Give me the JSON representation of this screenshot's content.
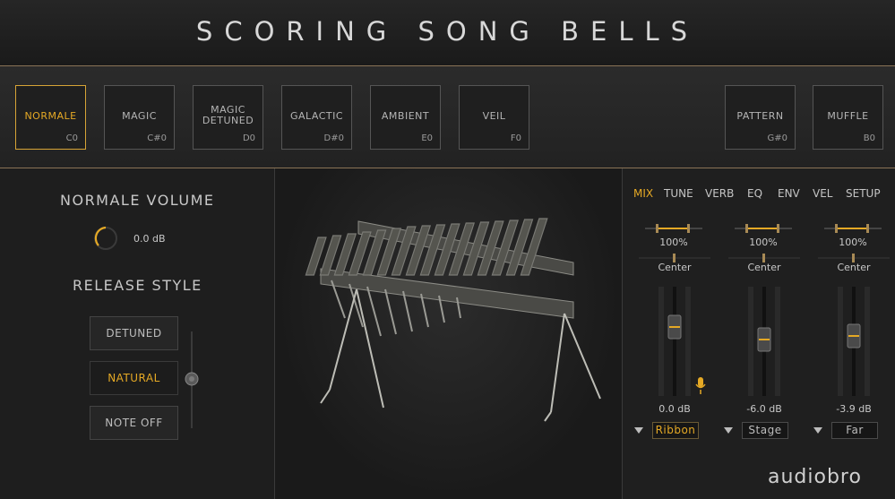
{
  "header": {
    "title": "SCORING SONG BELLS"
  },
  "articulations": [
    {
      "name": "NORMALE",
      "key": "C0",
      "active": true
    },
    {
      "name": "MAGIC",
      "key": "C#0"
    },
    {
      "name_line1": "MAGIC",
      "name_line2": "DETUNED",
      "key": "D0"
    },
    {
      "name": "GALACTIC",
      "key": "D#0"
    },
    {
      "name": "AMBIENT",
      "key": "E0"
    },
    {
      "name": "VEIL",
      "key": "F0"
    },
    {
      "name": "PATTERN",
      "key": "G#0"
    },
    {
      "name": "MUFFLE",
      "key": "B0"
    }
  ],
  "left": {
    "volume_label": "NORMALE VOLUME",
    "volume_value": "0.0 dB",
    "release_label": "RELEASE STYLE",
    "release_options": [
      "DETUNED",
      "NATURAL",
      "NOTE OFF"
    ],
    "release_selected": "NATURAL"
  },
  "tabs": [
    "MIX",
    "TUNE",
    "VERB",
    "EQ",
    "ENV",
    "VEL",
    "SETUP"
  ],
  "active_tab": "MIX",
  "mix": {
    "channels": [
      {
        "width": "100%",
        "pan": "Center",
        "level": "0.0 dB",
        "mic": "Ribbon"
      },
      {
        "width": "100%",
        "pan": "Center",
        "level": "-6.0 dB",
        "mic": "Stage"
      },
      {
        "width": "100%",
        "pan": "Center",
        "level": "-3.9 dB",
        "mic": "Far"
      }
    ]
  },
  "brand": "audiobro",
  "colors": {
    "accent": "#e5a925",
    "divider": "#8a7356"
  }
}
